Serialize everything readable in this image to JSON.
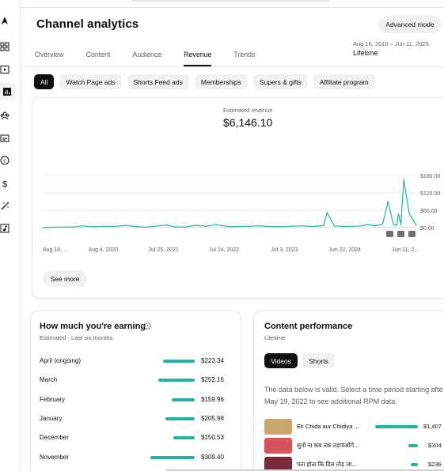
{
  "rail": {
    "icons": [
      "logo-icon",
      "dashboard-icon",
      "content-icon",
      "analytics-icon",
      "community-icon",
      "subtitles-icon",
      "copyright-icon",
      "earn-icon",
      "customization-icon",
      "audio-library-icon"
    ]
  },
  "header": {
    "title": "Channel analytics",
    "advanced_mode": "Advanced mode",
    "date_range": "Aug 16, 2019 – Jun 11, 2025",
    "period": "Lifetime"
  },
  "tabs": [
    {
      "label": "Overview",
      "active": false
    },
    {
      "label": "Content",
      "active": false
    },
    {
      "label": "Audience",
      "active": false
    },
    {
      "label": "Revenue",
      "active": true
    },
    {
      "label": "Trends",
      "active": false
    }
  ],
  "chips": [
    {
      "label": "All",
      "active": true
    },
    {
      "label": "Watch Page ads",
      "active": false
    },
    {
      "label": "Shorts Feed ads",
      "active": false
    },
    {
      "label": "Memberships",
      "active": false
    },
    {
      "label": "Supers & gifts",
      "active": false
    },
    {
      "label": "Affiliate program",
      "active": false
    }
  ],
  "revenue": {
    "label": "Estimated revenue",
    "value": "$6,146.10",
    "see_more": "See more"
  },
  "chart_data": {
    "type": "line",
    "title": "",
    "x_tick_labels": [
      "Aug 16, ...",
      "Aug 4, 2020",
      "Jul 25, 2021",
      "Jul 14, 2022",
      "Jul 3, 2023",
      "Jun 22, 2024",
      "Jun 11, 2..."
    ],
    "y_tick_labels": [
      "$0.00",
      "$60.00",
      "$120.00",
      "$180.00"
    ],
    "ylim": [
      0,
      180
    ],
    "series": [
      {
        "color": "#1fb5a2",
        "x": [
          "2019-08-16",
          "2019-10-01",
          "2019-12-01",
          "2020-02-01",
          "2020-04-01",
          "2020-06-01",
          "2020-08-04",
          "2020-10-01",
          "2020-12-01",
          "2021-02-01",
          "2021-04-01",
          "2021-06-01",
          "2021-07-25",
          "2021-09-01",
          "2021-11-01",
          "2022-01-01",
          "2022-03-01",
          "2022-05-01",
          "2022-07-14",
          "2022-09-01",
          "2022-11-01",
          "2023-01-01",
          "2023-03-01",
          "2023-05-01",
          "2023-07-03",
          "2023-09-01",
          "2023-11-01",
          "2024-01-01",
          "2024-01-20",
          "2024-03-01",
          "2024-05-01",
          "2024-06-22",
          "2024-08-01",
          "2024-09-01",
          "2024-10-01",
          "2024-11-01",
          "2024-12-01",
          "2025-01-01",
          "2025-02-01",
          "2025-02-20",
          "2025-03-01",
          "2025-03-15",
          "2025-04-01",
          "2025-05-01",
          "2025-06-11"
        ],
        "values": [
          0,
          1,
          2,
          2,
          6,
          3,
          5,
          4,
          8,
          3,
          2,
          6,
          9,
          3,
          2,
          8,
          5,
          10,
          3,
          4,
          5,
          6,
          4,
          3,
          5,
          6,
          4,
          7,
          52,
          6,
          4,
          5,
          6,
          10,
          8,
          7,
          12,
          90,
          10,
          8,
          48,
          10,
          165,
          50,
          8
        ]
      }
    ],
    "legend": "none",
    "grid": true
  },
  "earning": {
    "title": "How much you're earning",
    "subtitle": "Estimated · Last six months",
    "rows": [
      {
        "month": "April (ongoing)",
        "value": "$223.34",
        "amount": 223.34
      },
      {
        "month": "March",
        "value": "$252.16",
        "amount": 252.16
      },
      {
        "month": "February",
        "value": "$159.96",
        "amount": 159.96
      },
      {
        "month": "January",
        "value": "$205.98",
        "amount": 205.98
      },
      {
        "month": "December",
        "value": "$150.53",
        "amount": 150.53
      },
      {
        "month": "November",
        "value": "$309.40",
        "amount": 309.4
      }
    ]
  },
  "performance": {
    "title": "Content performance",
    "subtitle": "Lifetime",
    "chip_videos": "Videos",
    "chip_shorts": "Shorts",
    "note": "The data below is valid. Select a time period starting afte May 19, 2022 to see additional RPM data.",
    "videos": [
      {
        "title": "Ek Chida aur Chidiya ...",
        "value": "$1,407",
        "amount": 1407,
        "thumb_color": "#c9a66b"
      },
      {
        "title": "सुनो ना कब तक तड़पाओगे...",
        "value": "$304",
        "amount": 304,
        "thumb_color": "#d4545c"
      },
      {
        "title": "पता होता कि दिल तोड़ जा...",
        "value": "$236",
        "amount": 236,
        "thumb_color": "#7a2a3a"
      }
    ]
  }
}
